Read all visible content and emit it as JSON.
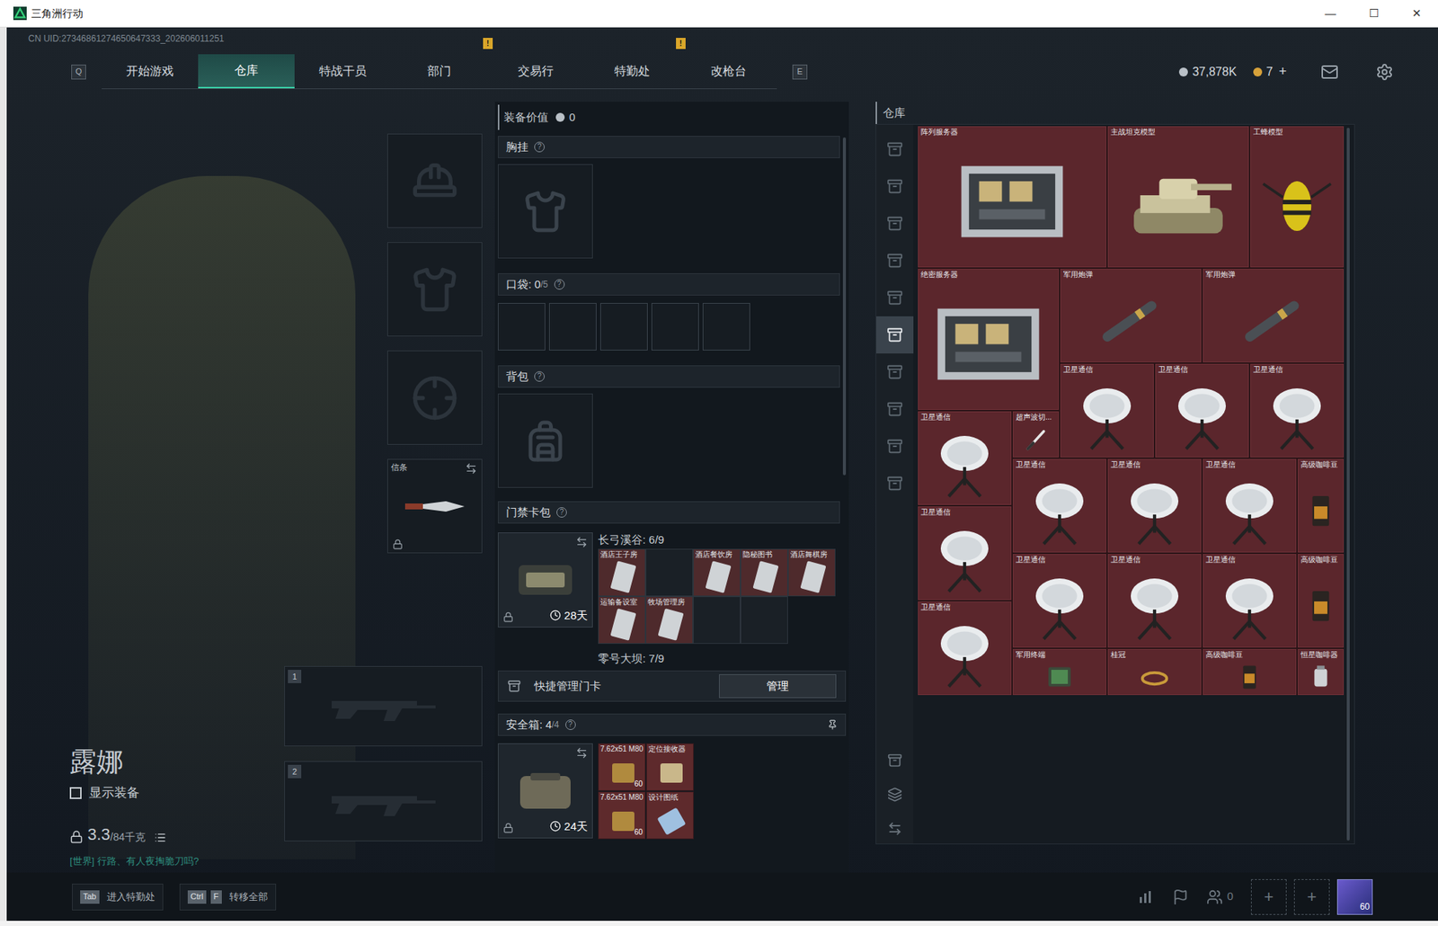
{
  "window": {
    "title": "三角洲行动",
    "controls": [
      "—",
      "☐",
      "✕"
    ]
  },
  "uid": "CN UID:27346861274650647333_202606011251",
  "nav": {
    "prev_key": "Q",
    "next_key": "E",
    "alert_mark": "!",
    "tabs": [
      {
        "label": "开始游戏",
        "selected": false,
        "alert": false
      },
      {
        "label": "仓库",
        "selected": true,
        "alert": false
      },
      {
        "label": "特战干员",
        "selected": false,
        "alert": false
      },
      {
        "label": "部门",
        "selected": false,
        "alert": true
      },
      {
        "label": "交易行",
        "selected": false,
        "alert": false
      },
      {
        "label": "特勤处",
        "selected": false,
        "alert": true
      },
      {
        "label": "改枪台",
        "selected": false,
        "alert": false
      }
    ]
  },
  "currency": {
    "items": [
      {
        "amount": "37,878K",
        "color": "#b9c0c7"
      },
      {
        "amount": "7",
        "color": "#d6a13a"
      }
    ],
    "add": "+"
  },
  "operator": {
    "name": "露娜",
    "show_equipment": {
      "label": "显示装备",
      "checked": false
    },
    "weight": "3.3",
    "capacity": "/84千克",
    "chat": "[世界] 行路、有人夜掏脆刀吗?"
  },
  "gear": {
    "slots": [
      {
        "kind": "helmet",
        "label": "",
        "locked": false
      },
      {
        "kind": "armor",
        "label": "",
        "locked": false
      },
      {
        "kind": "pistol",
        "label": "",
        "locked": false
      },
      {
        "kind": "melee",
        "label": "信条",
        "locked": true
      }
    ],
    "weapon_slots": [
      "1",
      "2"
    ]
  },
  "loadout": {
    "value_label": "装备价值",
    "value": "0",
    "help": "?",
    "chest_rig": {
      "title": "胸挂"
    },
    "pockets": {
      "title": "口袋:",
      "count": "0",
      "capacity": "/5",
      "slots": [
        false,
        false,
        false,
        false,
        false
      ]
    },
    "backpack": {
      "title": "背包"
    },
    "keycards": {
      "title": "门禁卡包",
      "days": "28天",
      "maps": [
        {
          "name": "长弓溪谷",
          "count": "6/9",
          "cards": [
            {
              "label": "酒店王子房",
              "filled": true
            },
            {
              "label": "",
              "filled": false
            },
            {
              "label": "酒店餐饮房",
              "filled": true
            },
            {
              "label": "隐秘图书",
              "filled": true
            },
            {
              "label": "酒店舞棋房",
              "filled": true
            },
            {
              "label": "运输备设室",
              "filled": true
            },
            {
              "label": "牧场管理房",
              "filled": true
            },
            {
              "label": "",
              "filled": false
            },
            {
              "label": "",
              "filled": false
            }
          ]
        },
        {
          "name": "零号大坝",
          "count": "7/9",
          "cards": []
        }
      ]
    },
    "quick_manage": {
      "label": "快捷管理门卡",
      "button": "管理"
    },
    "safe": {
      "title": "安全箱:",
      "count": "4/4",
      "days": "24天",
      "items": [
        {
          "label": "7.62x51 M80",
          "qty": "60",
          "kind": "ammo"
        },
        {
          "label": "定位接收器",
          "qty": "",
          "kind": "device"
        },
        {
          "label": "7.62x51 M80",
          "qty": "60",
          "kind": "ammo"
        },
        {
          "label": "设计图纸",
          "qty": "",
          "kind": "paper"
        }
      ]
    }
  },
  "warehouse": {
    "title": "仓库",
    "tabs": [
      {
        "selected": false
      },
      {
        "selected": false
      },
      {
        "selected": false
      },
      {
        "selected": false
      },
      {
        "selected": false
      },
      {
        "selected": true
      },
      {
        "selected": false
      },
      {
        "selected": false
      },
      {
        "selected": false
      },
      {
        "selected": false
      }
    ],
    "items": [
      {
        "name": "阵列服务器",
        "kind": "server"
      },
      {
        "name": "主战坦克模型",
        "kind": "tank"
      },
      {
        "name": "工蜂模型",
        "kind": "bee"
      },
      {
        "name": "绝密服务器",
        "kind": "server"
      },
      {
        "name": "军用炮弹",
        "kind": "shell"
      },
      {
        "name": "军用炮弹",
        "kind": "shell"
      },
      {
        "name": "卫星通信",
        "kind": "dish"
      },
      {
        "name": "卫星通信",
        "kind": "dish"
      },
      {
        "name": "卫星通信",
        "kind": "dish"
      },
      {
        "name": "卫星通信",
        "kind": "dish"
      },
      {
        "name": "超声波切...",
        "kind": "knife"
      },
      {
        "name": "卫星通信",
        "kind": "dish"
      },
      {
        "name": "卫星通信",
        "kind": "dish"
      },
      {
        "name": "卫星通信",
        "kind": "dish"
      },
      {
        "name": "高级咖啡豆",
        "kind": "coffee"
      },
      {
        "name": "卫星通信",
        "kind": "dish"
      },
      {
        "name": "卫星通信",
        "kind": "dish"
      },
      {
        "name": "卫星通信",
        "kind": "dish"
      },
      {
        "name": "卫星通信",
        "kind": "dish"
      },
      {
        "name": "高级咖啡豆",
        "kind": "coffee"
      },
      {
        "name": "卫星通信",
        "kind": "dish"
      },
      {
        "name": "军用终端",
        "kind": "terminal"
      },
      {
        "name": "桂冠",
        "kind": "crown"
      },
      {
        "name": "高级咖啡豆",
        "kind": "coffee"
      },
      {
        "name": "恒星咖啡器",
        "kind": "grinder"
      }
    ]
  },
  "bottom": {
    "hints": [
      {
        "keys": [
          "Tab"
        ],
        "label": "进入特勤处"
      },
      {
        "keys": [
          "Ctrl",
          "F"
        ],
        "label": "转移全部"
      }
    ],
    "friends": "0",
    "add": "+",
    "level": "60"
  }
}
